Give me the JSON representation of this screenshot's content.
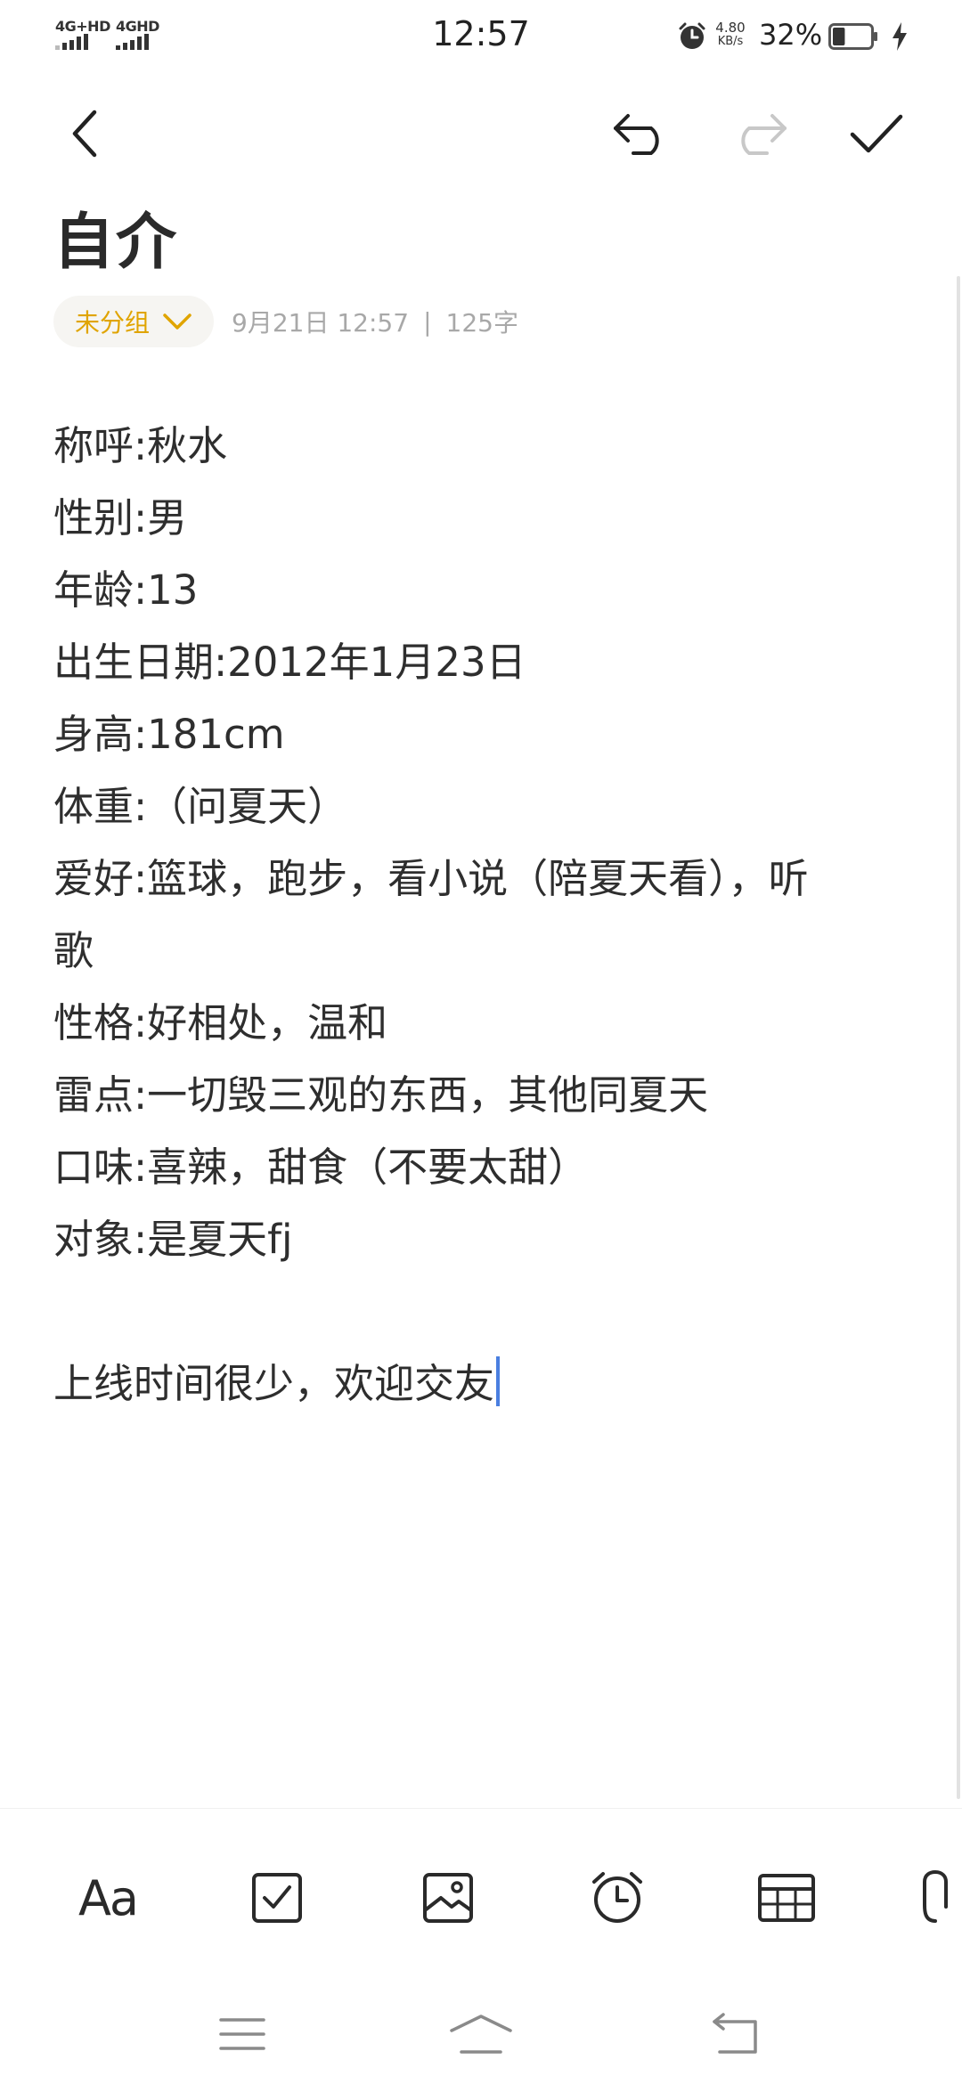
{
  "status_bar": {
    "network_1": "4G+HD",
    "network_2": "4GHD",
    "time": "12:57",
    "net_speed_value": "4.80",
    "net_speed_unit": "KB/s",
    "battery_percent": "32%",
    "battery_level": 0.32,
    "icons": [
      "alarm-icon",
      "battery-icon",
      "charging-icon"
    ]
  },
  "top_bar": {
    "icons": [
      "back-icon",
      "undo-icon",
      "redo-icon",
      "check-icon"
    ]
  },
  "note": {
    "title": "自介",
    "group_label": "未分组",
    "date": "9月21日 12:57",
    "separator": "|",
    "word_count": "125字",
    "lines": [
      "称呼:秋水",
      "性别:男",
      "年龄:13",
      "出生日期:2012年1月23日",
      "身高:181cm",
      "体重:（问夏天）",
      "爱好:篮球，跑步，看小说（陪夏天看），听",
      "歌",
      "性格:好相处，温和",
      "雷点:一切毁三观的东西，其他同夏天",
      "口味:喜辣，甜食（不要太甜）",
      "对象:是夏天fj",
      "",
      "上线时间很少，欢迎交友"
    ]
  },
  "toolbar": {
    "font_label": "Aa",
    "icons": [
      "font-style-icon",
      "checklist-icon",
      "image-icon",
      "alarm-reminder-icon",
      "table-icon",
      "attachment-icon"
    ]
  },
  "nav_bar": {
    "icons": [
      "menu-icon",
      "home-icon",
      "back-nav-icon"
    ]
  },
  "colors": {
    "accent": "#e0a400",
    "caret": "#4a7fe0",
    "meta_text": "#a8a8a8"
  }
}
